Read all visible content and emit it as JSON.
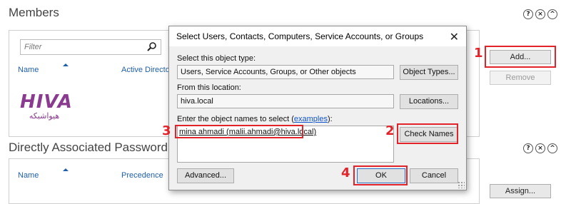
{
  "members": {
    "title": "Members",
    "filter_placeholder": "Filter",
    "columns": [
      "Name",
      "Active Directo"
    ],
    "add_button": "Add...",
    "remove_button": "Remove"
  },
  "header_controls": {
    "help": "?",
    "close": "×",
    "collapse": "^"
  },
  "password_settings": {
    "title": "Directly Associated Password Se",
    "columns": [
      "Name",
      "Precedence"
    ],
    "assign_button": "Assign..."
  },
  "logo": {
    "word": "HIVA",
    "subtitle": "هیواشبکه"
  },
  "dialog": {
    "title": "Select Users, Contacts, Computers, Service Accounts, or Groups",
    "object_type_label": "Select this object type:",
    "object_type_value": "Users, Service Accounts, Groups, or Other objects",
    "object_types_button": "Object Types...",
    "location_label": "From this location:",
    "location_value": "hiva.local",
    "locations_button": "Locations...",
    "names_label_prefix": "Enter the object names to select (",
    "names_label_link": "examples",
    "names_label_suffix": "):",
    "names_value": "mina ahmadi (malii.ahmadi@hiva.local)",
    "check_names_button": "Check Names",
    "advanced_button": "Advanced...",
    "ok_button": "OK",
    "cancel_button": "Cancel",
    "close_glyph": "✕"
  },
  "annotations": [
    "1",
    "2",
    "3",
    "4"
  ],
  "colors": {
    "highlight": "#e2232a",
    "header_link": "#1f5fa8",
    "logo": "#8a3b8f"
  }
}
